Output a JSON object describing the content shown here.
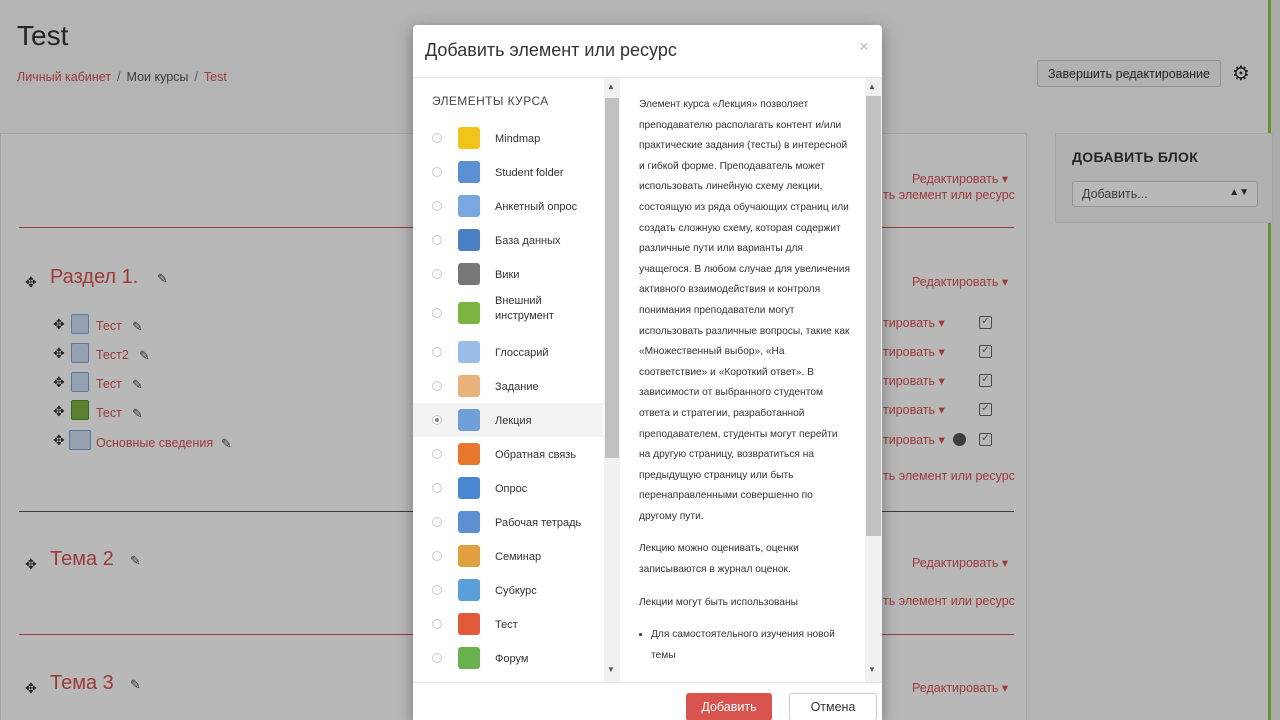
{
  "page": {
    "title": "Test",
    "breadcrumb": [
      "Личный кабинет",
      "Мои курсы",
      "Test"
    ],
    "breadcrumb_sep": "/",
    "finish_editing": "Завершить редактирование"
  },
  "block": {
    "title": "ДОБАВИТЬ БЛОК",
    "select_value": "Добавить...",
    "select_arrows": "▲▼"
  },
  "course": {
    "edit_label": "Редактировать ▾",
    "edit_short": "тировать ▾",
    "add_resource": "ть элемент или ресурс",
    "sections": [
      {
        "title": "Раздел 1."
      },
      {
        "title": "Тема 2"
      },
      {
        "title": "Тема 3"
      }
    ],
    "activities": [
      "Тест",
      "Тест2",
      "Тест",
      "Тест",
      "Основные сведения"
    ]
  },
  "modal": {
    "title": "Добавить элемент или ресурс",
    "close": "×",
    "list_heading": "ЭЛЕМЕНТЫ КУРСА",
    "items": [
      {
        "label": "Mindmap",
        "icon": "lightbulb-icon",
        "color": "#f0c419"
      },
      {
        "label": "Student folder",
        "icon": "folder-icon",
        "color": "#5b8fd1"
      },
      {
        "label": "Анкетный опрос",
        "icon": "survey-icon",
        "color": "#7aa7e0"
      },
      {
        "label": "База данных",
        "icon": "database-icon",
        "color": "#4a7fc1"
      },
      {
        "label": "Вики",
        "icon": "wiki-icon",
        "color": "#777777"
      },
      {
        "label": "Внешний инструмент",
        "icon": "puzzle-icon",
        "color": "#7cb342"
      },
      {
        "label": "Глоссарий",
        "icon": "glossary-icon",
        "color": "#9bbce6"
      },
      {
        "label": "Задание",
        "icon": "assignment-icon",
        "color": "#e8b27a"
      },
      {
        "label": "Лекция",
        "icon": "lesson-icon",
        "color": "#6f9fd8"
      },
      {
        "label": "Обратная связь",
        "icon": "megaphone-icon",
        "color": "#e8772e"
      },
      {
        "label": "Опрос",
        "icon": "question-icon",
        "color": "#4a86d1"
      },
      {
        "label": "Рабочая тетрадь",
        "icon": "workbook-icon",
        "color": "#5b8fd1"
      },
      {
        "label": "Семинар",
        "icon": "workshop-icon",
        "color": "#e0a040"
      },
      {
        "label": "Субкурс",
        "icon": "subcourse-icon",
        "color": "#5aa0d8"
      },
      {
        "label": "Тест",
        "icon": "quiz-icon",
        "color": "#e25a3a"
      },
      {
        "label": "Форум",
        "icon": "forum-icon",
        "color": "#6ab04c"
      }
    ],
    "selected_index": 8,
    "description": [
      "Элемент курса «Лекция» позволяет преподавателю располагать контент и/или практические задания (тесты) в интересной и гибкой форме. Преподаватель может использовать линейную схему лекции, состоящую из ряда обучающих страниц или создать сложную схему, которая содержит различные пути или варианты для учащегося. В любом случае для увеличения активного взаимодействия и контроля понимания преподаватели могут использовать различные вопросы, такие как «Множественный выбор», «На соответствие» и «Короткий ответ». В зависимости от выбранного студентом ответа и стратегии, разработанной преподавателем, студенты могут перейти на другую страницу, возвратиться на предыдущую страницу или быть перенаправленными совершенно по другому пути.",
      "Лекцию можно оценивать, оценки записываются в журнал оценок.",
      "Лекции могут быть использованы"
    ],
    "description_list": [
      "Для самостоятельного изучения новой темы"
    ],
    "add_button": "Добавить",
    "cancel_button": "Отмена"
  },
  "colors": {
    "accent": "#d9534f",
    "green_strip": "#8ec63f"
  }
}
